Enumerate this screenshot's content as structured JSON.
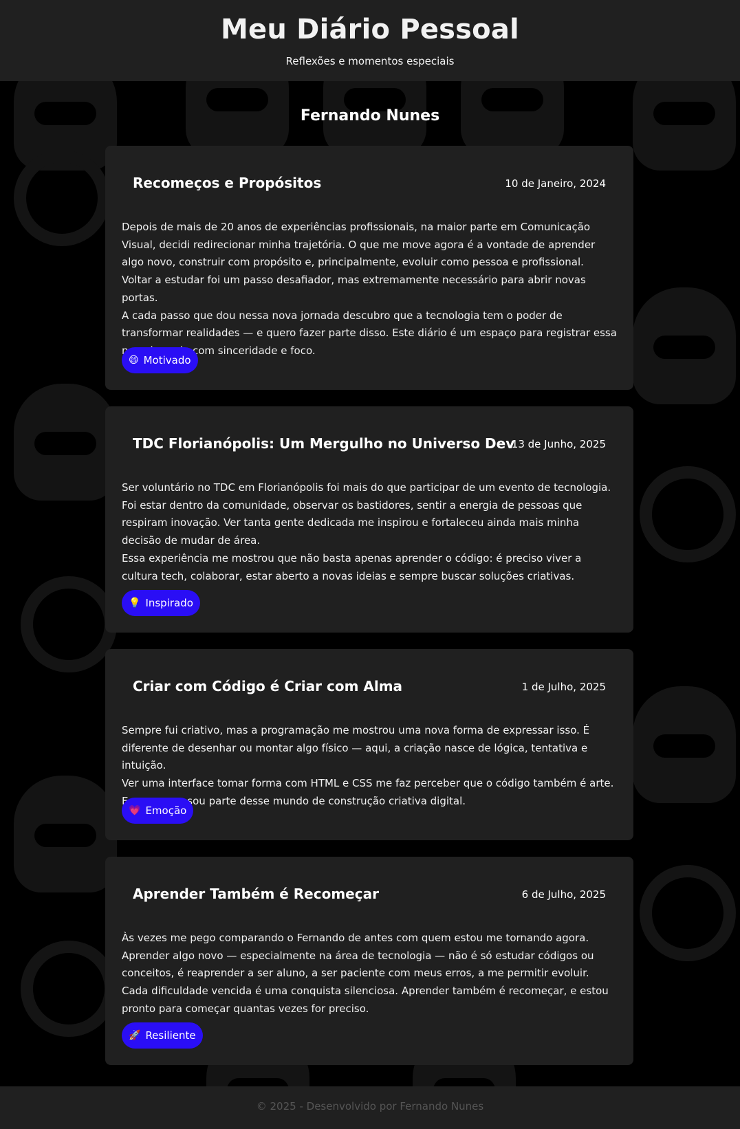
{
  "header": {
    "title": "Meu Diário Pessoal",
    "subtitle": "Reflexões e momentos especiais"
  },
  "author": "Fernando Nunes",
  "entries": [
    {
      "title": "Recomeços e Propósitos",
      "date": "10 de Janeiro, 2024",
      "paragraphs": [
        "Depois de mais de 20 anos de experiências profissionais, na maior parte em Comunicação Visual, decidi redirecionar minha trajetória. O que me move agora é a vontade de aprender algo novo, construir com propósito e, principalmente, evoluir como pessoa e profissional. Voltar a estudar foi um passo desafiador, mas extremamente necessário para abrir novas portas.",
        "A cada passo que dou nessa nova jornada descubro que a tecnologia tem o poder de transformar realidades — e quero fazer parte disso. Este diário é um espaço para registrar essa nova jornada com sinceridade e foco."
      ],
      "mood_emoji": "😄",
      "mood_label": "Motivado"
    },
    {
      "title": "TDC Florianópolis: Um Mergulho no Universo Dev",
      "date": "13 de Junho, 2025",
      "paragraphs": [
        "Ser voluntário no TDC em Florianópolis foi mais do que participar de um evento de tecnologia. Foi estar dentro da comunidade, observar os bastidores, sentir a energia de pessoas que respiram inovação. Ver tanta gente dedicada me inspirou e fortaleceu ainda mais minha decisão de mudar de área.",
        "Essa experiência me mostrou que não basta apenas aprender o código: é preciso viver a cultura tech, colaborar, estar aberto a novas ideias e sempre buscar soluções criativas."
      ],
      "mood_emoji": "💡",
      "mood_label": "Inspirado"
    },
    {
      "title": "Criar com Código é Criar com Alma",
      "date": "1 de Julho, 2025",
      "paragraphs": [
        "Sempre fui criativo, mas a programação me mostrou uma nova forma de expressar isso. É diferente de desenhar ou montar algo físico — aqui, a criação nasce de lógica, tentativa e intuição.",
        "Ver uma interface tomar forma com HTML e CSS me faz perceber que o código também é arte. E eu, agora, sou parte desse mundo de construção criativa digital."
      ],
      "mood_emoji": "💗",
      "mood_label": "Emoção"
    },
    {
      "title": "Aprender Também é Recomeçar",
      "date": "6 de Julho, 2025",
      "paragraphs": [
        "Às vezes me pego comparando o Fernando de antes com quem estou me tornando agora. Aprender algo novo — especialmente na área de tecnologia — não é só estudar códigos ou conceitos, é reaprender a ser aluno, a ser paciente com meus erros, a me permitir evoluir.",
        "Cada dificuldade vencida é uma conquista silenciosa. Aprender também é recomeçar, e estou pronto para começar quantas vezes for preciso."
      ],
      "mood_emoji": "🚀",
      "mood_label": "Resiliente"
    }
  ],
  "footer": {
    "text": "© 2025 - Desenvolvido por Fernando Nunes"
  },
  "colors": {
    "background": "#000000",
    "card": "#202020",
    "accent": "#2a0ef5"
  }
}
